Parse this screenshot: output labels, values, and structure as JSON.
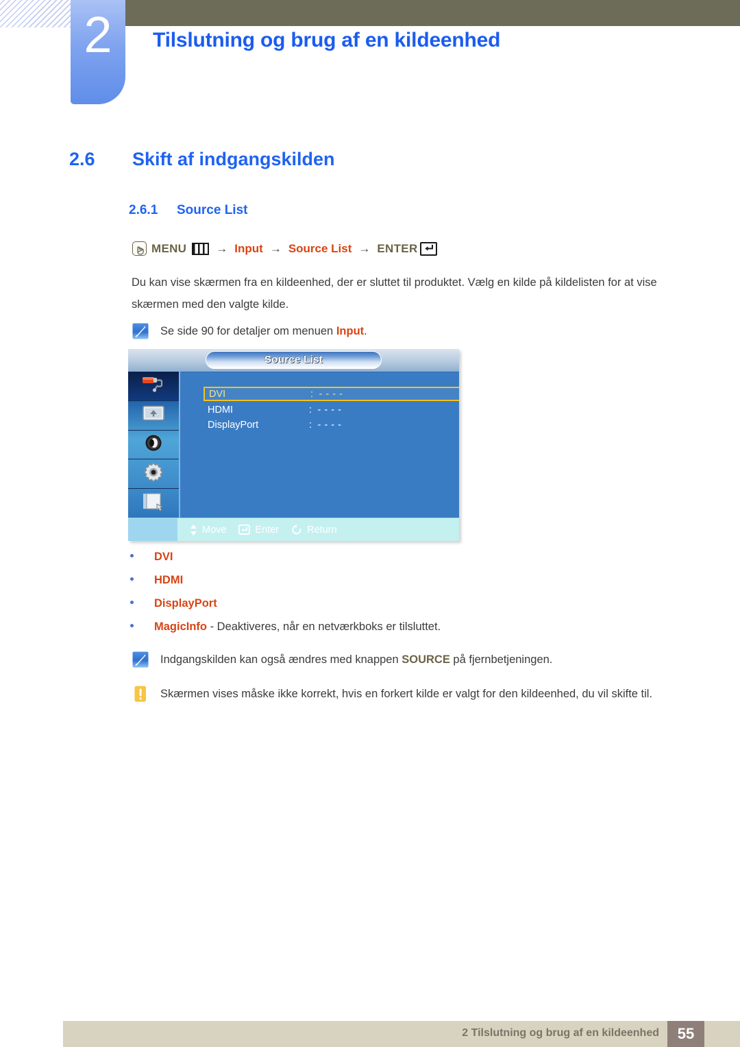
{
  "header": {
    "chapter_number": "2",
    "chapter_title": "Tilslutning og brug af en kildeenhed",
    "accent_blue": "#1b5cf0",
    "olive_bar_color": "#6d6c59",
    "badge_gradient_from": "#a9c1f5",
    "badge_gradient_to": "#5f8de9"
  },
  "section": {
    "h2_number": "2.6",
    "h2_title": "Skift af indgangskilden",
    "h3_number": "2.6.1",
    "h3_title": "Source List"
  },
  "path": {
    "menu_button_icon": "hand-press-icon",
    "menu_label": "MENU",
    "menu_bars_icon": "three-bars-icon",
    "arrow": "→",
    "step_input": "Input",
    "step_source_list": "Source List",
    "enter_label": "ENTER",
    "enter_icon": "enter-return-icon",
    "olive_color": "#6b6345",
    "red_color": "#d94413"
  },
  "paragraph": "Du kan vise skærmen fra en kildeenhed, der er sluttet til produktet. Vælg en kilde på kildelisten for at vise skærmen med den valgte kilde.",
  "notes": {
    "note1_icon": "note-pencil-icon",
    "note1_prefix": "Se side 90 for detaljer om menuen ",
    "note1_emphasis": "Input",
    "note1_suffix": ".",
    "note2_icon": "note-pencil-icon",
    "note2_prefix": "Indgangskilden kan også ændres med knappen ",
    "note2_emphasis": "SOURCE",
    "note2_suffix": " på fjernbetjeningen.",
    "warning_icon": "warning-exclamation-icon",
    "warning_text": "Skærmen vises måske ikke korrekt, hvis en forkert kilde er valgt for den kildeenhed, du vil skifte til."
  },
  "osd": {
    "title": "Source List",
    "sidebar_icons": [
      "paint-roller-icon",
      "screen-monitor-icon",
      "speaker-icon",
      "gear-setup-icon",
      "multi-control-icon"
    ],
    "rows": [
      {
        "label": "DVI",
        "separator": ":",
        "value": "- - - -",
        "selected": true
      },
      {
        "label": "HDMI",
        "separator": ":",
        "value": "- - - -",
        "selected": false
      },
      {
        "label": "DisplayPort",
        "separator": ":",
        "value": "- - - -",
        "selected": false
      }
    ],
    "hints": [
      {
        "icon": "up-down-arrow-icon",
        "label": "Move"
      },
      {
        "icon": "enter-key-icon",
        "label": "Enter"
      },
      {
        "icon": "return-circle-icon",
        "label": "Return"
      }
    ],
    "selection_border_color": "#f2c21a",
    "background_color": "#3a7cc4",
    "bottom_bar_color": "#c5f0f0"
  },
  "bullets": [
    {
      "label": "DVI",
      "rest": ""
    },
    {
      "label": "HDMI",
      "rest": ""
    },
    {
      "label": "DisplayPort",
      "rest": ""
    },
    {
      "label": "MagicInfo",
      "rest": " - Deaktiveres, når en netværkboks er tilsluttet."
    }
  ],
  "footer": {
    "text": "2 Tilslutning og brug af en kildeenhed",
    "page_number": "55",
    "bar_color": "#d8d3c0",
    "page_box_color": "#8e7f78"
  }
}
